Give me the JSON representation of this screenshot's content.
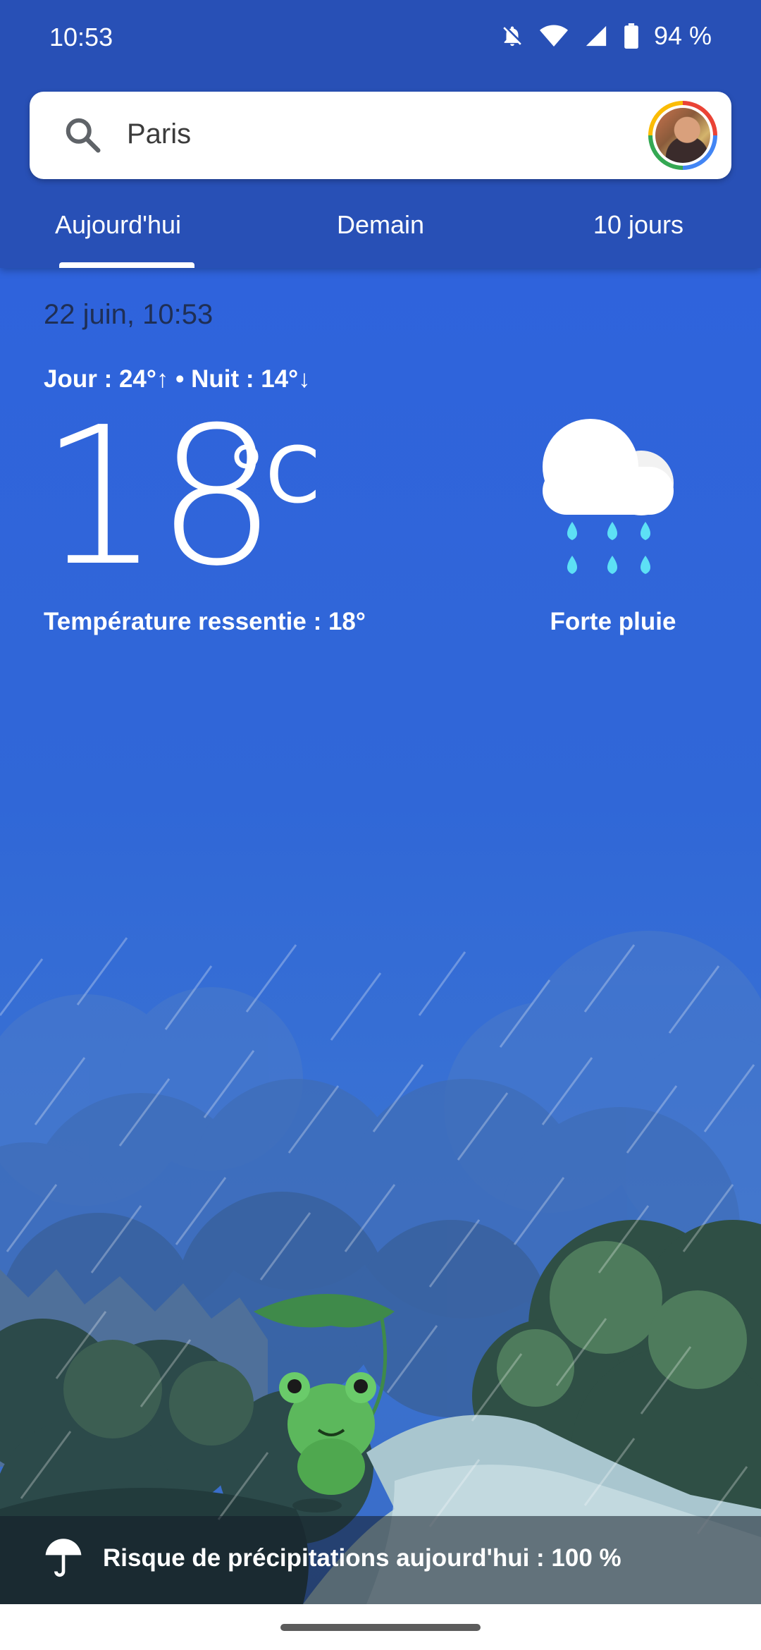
{
  "status_bar": {
    "time": "10:53",
    "battery": "94 %",
    "icons": [
      "bell-off-icon",
      "wifi-icon",
      "signal-icon",
      "battery-icon"
    ]
  },
  "search": {
    "value": "Paris",
    "icon": "search-icon",
    "avatar": "profile-avatar"
  },
  "tabs": [
    {
      "label": "Aujourd'hui",
      "selected": true
    },
    {
      "label": "Demain",
      "selected": false
    },
    {
      "label": "10 jours",
      "selected": false
    }
  ],
  "weather": {
    "date": "22 juin, 10:53",
    "day_night": "Jour : 24°↑ • Nuit : 14°↓",
    "temperature": "18",
    "unit": "°C",
    "feels_like": "Température ressentie : 18°",
    "condition": "Forte pluie",
    "condition_icon": "heavy-rain-icon"
  },
  "precipitation": {
    "text": "Risque de précipitations aujourd'hui : 100 %",
    "icon": "umbrella-icon"
  },
  "colors": {
    "header": "#2850b6",
    "sky": "#2f63dc",
    "raindrop": "#5de0f5"
  }
}
